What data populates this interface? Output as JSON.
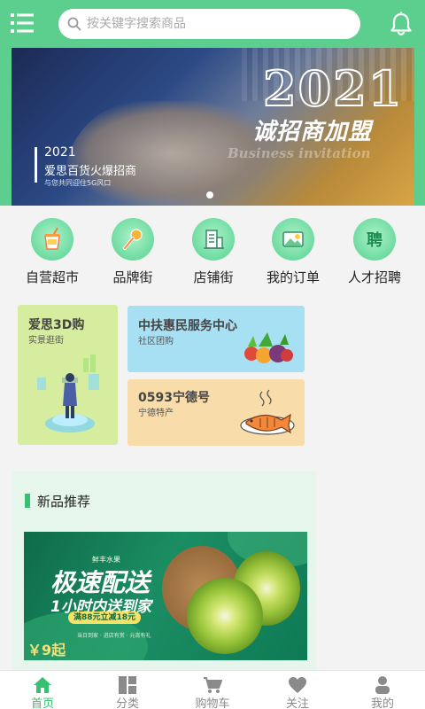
{
  "colors": {
    "primary": "#5ccf8f",
    "accent": "#37c072",
    "inactive": "#8a8a8a"
  },
  "header": {
    "menu_icon": "list-menu-icon",
    "search": {
      "placeholder": "按关键字搜索商品",
      "icon": "search-icon"
    },
    "bell_icon": "bell-icon"
  },
  "banner": {
    "year_big": "2021",
    "slogan": "诚招商加盟",
    "subtitle_en": "Business invitation",
    "year_small": "2021",
    "caption": "爱思百货火爆招商",
    "tagline": "与您共同迎住5G风口"
  },
  "categories": [
    {
      "label": "自营超市",
      "icon": "drink-icon"
    },
    {
      "label": "品牌街",
      "icon": "microphone-icon"
    },
    {
      "label": "店铺街",
      "icon": "building-icon"
    },
    {
      "label": "我的订单",
      "icon": "landscape-icon"
    },
    {
      "label": "人才招聘",
      "icon": "recruit-icon"
    }
  ],
  "promos": {
    "card1": {
      "title": "爱思3D购",
      "subtitle": "实景逛街"
    },
    "card2": {
      "title": "中扶惠民服务中心",
      "subtitle": "社区团购"
    },
    "card3": {
      "title": "0593宁德号",
      "subtitle": "宁德特产"
    }
  },
  "new_products": {
    "title": "新品推荐",
    "banner": {
      "brand": "鲜丰水果",
      "headline": "极速配送",
      "line2": "1小时内送到家",
      "coupon": "满88元立减18元",
      "tags": "当日到家 · 进店有赏 · 元宵有礼",
      "price": "￥9起"
    }
  },
  "bottom_nav": [
    {
      "label": "首页",
      "icon": "home-icon",
      "active": true
    },
    {
      "label": "分类",
      "icon": "category-icon",
      "active": false
    },
    {
      "label": "购物车",
      "icon": "cart-icon",
      "active": false
    },
    {
      "label": "关注",
      "icon": "heart-icon",
      "active": false
    },
    {
      "label": "我的",
      "icon": "user-icon",
      "active": false
    }
  ]
}
